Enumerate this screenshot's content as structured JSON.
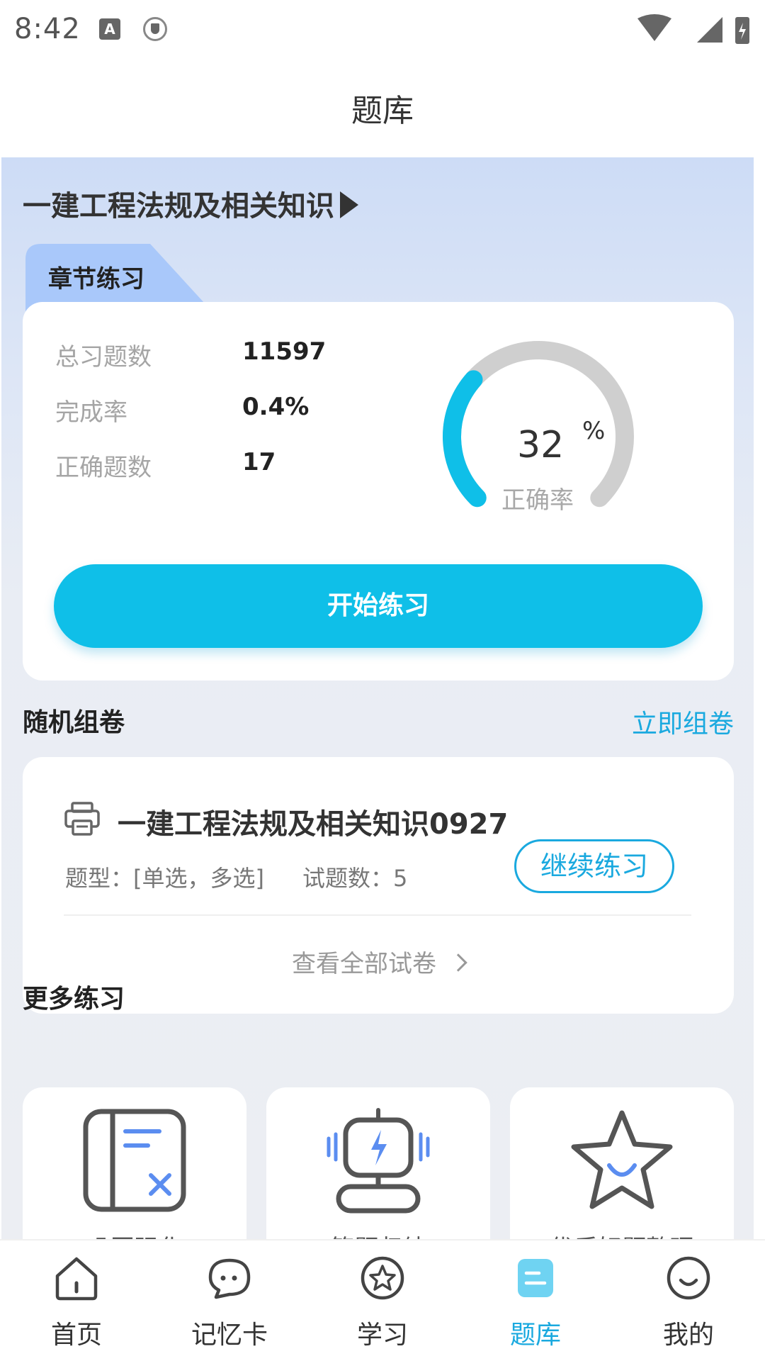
{
  "status_bar": {
    "time": "8:42",
    "notification_badge": "A"
  },
  "header": {
    "title": "题库"
  },
  "subject": {
    "name": "一建工程法规及相关知识"
  },
  "chapter_practice": {
    "tab_label": "章节练习",
    "stats": [
      {
        "label": "总习题数",
        "value": "11597"
      },
      {
        "label": "完成率",
        "value": "0.4%"
      },
      {
        "label": "正确题数",
        "value": "17"
      }
    ],
    "accuracy": {
      "value": "32",
      "unit": "%",
      "label": "正确率",
      "fraction": 0.32
    },
    "start_button": "开始练习"
  },
  "random_paper": {
    "title": "随机组卷",
    "action": "立即组卷",
    "paper": {
      "name": "一建工程法规及相关知识0927",
      "type_text": "题型：[单选，多选]",
      "count_text": "试题数：5",
      "continue_button": "继续练习"
    },
    "view_all": "查看全部试卷"
  },
  "more_practice": {
    "title": "更多练习",
    "tiles": [
      {
        "label": "巩固强化",
        "icon": "wrong-book-icon"
      },
      {
        "label": "答题归纳",
        "icon": "robot-icon"
      },
      {
        "label": "优质好题整理",
        "icon": "star-smile-icon"
      }
    ]
  },
  "tab_bar": {
    "items": [
      {
        "label": "首页",
        "icon": "home-icon"
      },
      {
        "label": "记忆卡",
        "icon": "chat-bubble-icon"
      },
      {
        "label": "学习",
        "icon": "star-badge-icon"
      },
      {
        "label": "题库",
        "icon": "question-bank-icon",
        "active": true
      },
      {
        "label": "我的",
        "icon": "profile-face-icon"
      }
    ]
  },
  "colors": {
    "accent": "#0fbfe8",
    "link": "#1aa9df",
    "gauge_track": "#cfcfcf",
    "tab_active": "#1aa9df"
  }
}
